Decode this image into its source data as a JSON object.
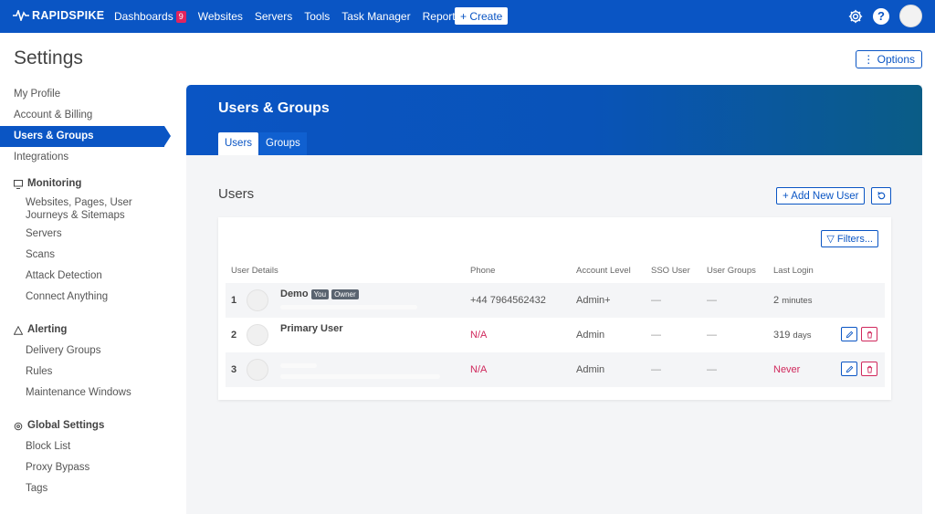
{
  "header": {
    "logo_text": "RAPIDSPIKE",
    "nav": [
      {
        "label": "Dashboards",
        "badge": "9"
      },
      {
        "label": "Websites"
      },
      {
        "label": "Servers"
      },
      {
        "label": "Tools"
      },
      {
        "label": "Task Manager"
      },
      {
        "label": "Reports"
      }
    ],
    "create_label": "+ Create",
    "help_label": "?"
  },
  "page": {
    "title": "Settings",
    "options_label": "⋮ Options"
  },
  "sidebar": {
    "top_items": [
      {
        "label": "My Profile"
      },
      {
        "label": "Account & Billing"
      },
      {
        "label": "Users & Groups",
        "active": true
      },
      {
        "label": "Integrations"
      }
    ],
    "monitoring": {
      "label": "Monitoring",
      "icon": "monitor-icon",
      "items": [
        {
          "label": "Websites, Pages, User Journeys & Sitemaps"
        },
        {
          "label": "Servers"
        },
        {
          "label": "Scans"
        },
        {
          "label": "Attack Detection"
        },
        {
          "label": "Connect Anything"
        }
      ]
    },
    "alerting": {
      "label": "Alerting",
      "icon": "warning-icon",
      "items": [
        {
          "label": "Delivery Groups"
        },
        {
          "label": "Rules"
        },
        {
          "label": "Maintenance Windows"
        }
      ]
    },
    "global": {
      "label": "Global Settings",
      "icon": "cog-icon",
      "items": [
        {
          "label": "Block List"
        },
        {
          "label": "Proxy Bypass"
        },
        {
          "label": "Tags"
        }
      ]
    }
  },
  "panel": {
    "title": "Users & Groups",
    "tabs": [
      {
        "label": "Users",
        "active": true
      },
      {
        "label": "Groups",
        "active": false
      }
    ],
    "section_title": "Users",
    "add_user_label": "+ Add New User",
    "filters_label": "▽ Filters...",
    "columns": [
      "User Details",
      "Phone",
      "Account Level",
      "SSO User",
      "User Groups",
      "Last Login"
    ],
    "rows": [
      {
        "num": "1",
        "name": "Demo",
        "tags": [
          "You",
          "Owner"
        ],
        "phone": "+44 7964562432",
        "level": "Admin+",
        "sso": "—",
        "groups": "—",
        "last_login": "2",
        "last_login_unit": "minutes",
        "has_actions": false
      },
      {
        "num": "2",
        "name": "Primary User",
        "tags": [],
        "phone": "N/A",
        "level": "Admin",
        "sso": "—",
        "groups": "—",
        "last_login": "319",
        "last_login_unit": "days",
        "has_actions": true
      },
      {
        "num": "3",
        "name": "",
        "tags": [],
        "phone": "N/A",
        "level": "Admin",
        "sso": "—",
        "groups": "—",
        "last_login": "Never",
        "last_login_unit": "",
        "has_actions": true
      }
    ]
  },
  "colors": {
    "brand": "#0a55c4",
    "danger": "#d0285c"
  }
}
